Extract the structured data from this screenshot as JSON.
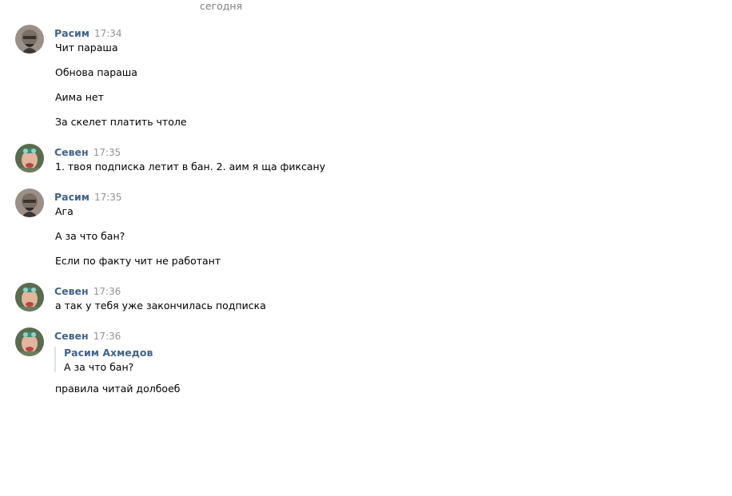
{
  "date_divider": "сегодня",
  "colors": {
    "author": "#42648b",
    "time": "#939393",
    "divider": "#828282",
    "reply_bar": "#dae2ea"
  },
  "messages": [
    {
      "author": "Расим",
      "time": "17:34",
      "avatar_icon": "user-avatar-rasim-icon",
      "lines": [
        "Чит параша",
        "Обнова параша",
        "Аима нет",
        "За скелет платить чтоле"
      ]
    },
    {
      "author": "Севен",
      "time": "17:35",
      "avatar_icon": "user-avatar-seven-icon",
      "lines": [
        "1. твоя подписка летит в бан. 2. аим я ща фиксану"
      ]
    },
    {
      "author": "Расим",
      "time": "17:35",
      "avatar_icon": "user-avatar-rasim-icon",
      "lines": [
        "Ага",
        "А за что бан?",
        "Если по факту чит не работант"
      ]
    },
    {
      "author": "Севен",
      "time": "17:36",
      "avatar_icon": "user-avatar-seven-icon",
      "lines": [
        "а так у тебя уже закончилась подписка"
      ]
    },
    {
      "author": "Севен",
      "time": "17:36",
      "avatar_icon": "user-avatar-seven-icon",
      "reply": {
        "author": "Расим Ахмедов",
        "text": "А за что бан?"
      },
      "lines": [
        "правила читай долбоеб"
      ]
    }
  ]
}
